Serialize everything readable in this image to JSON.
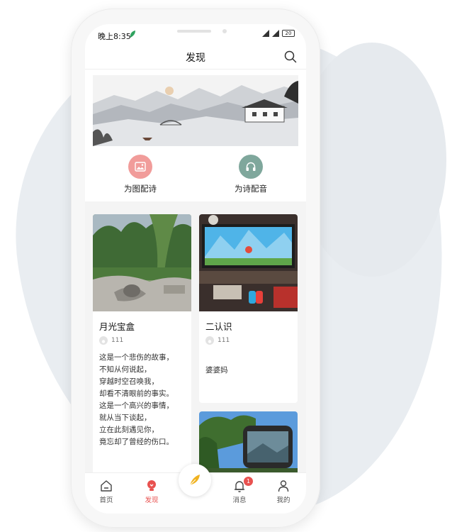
{
  "status_bar": {
    "time": "晚上8:35",
    "battery": "20"
  },
  "navbar": {
    "title": "发现"
  },
  "quick_actions": [
    {
      "label": "为图配诗",
      "color": "#f19c9a"
    },
    {
      "label": "为诗配音",
      "color": "#7fa79c"
    }
  ],
  "feed": [
    {
      "title": "月光宝盒",
      "user": "111",
      "lines": [
        "这是一个悲伤的故事，",
        "不知从何说起，",
        "穿越时空召唤我，",
        "却看不清眼前的事实。",
        "这是一个高兴的事情，",
        "就从当下谈起，",
        "立在此刻遇见你，",
        "竟忘却了曾经的伤口。"
      ]
    },
    {
      "title": "二认识",
      "user": "111",
      "lines": [
        "婆婆妈"
      ]
    }
  ],
  "tabbar": {
    "items": [
      {
        "label": "首页"
      },
      {
        "label": "发现"
      },
      {
        "label": "消息",
        "badge": "1"
      },
      {
        "label": "我的"
      }
    ]
  },
  "colors": {
    "accent": "#e8514f",
    "background": "#f4f4f4"
  }
}
